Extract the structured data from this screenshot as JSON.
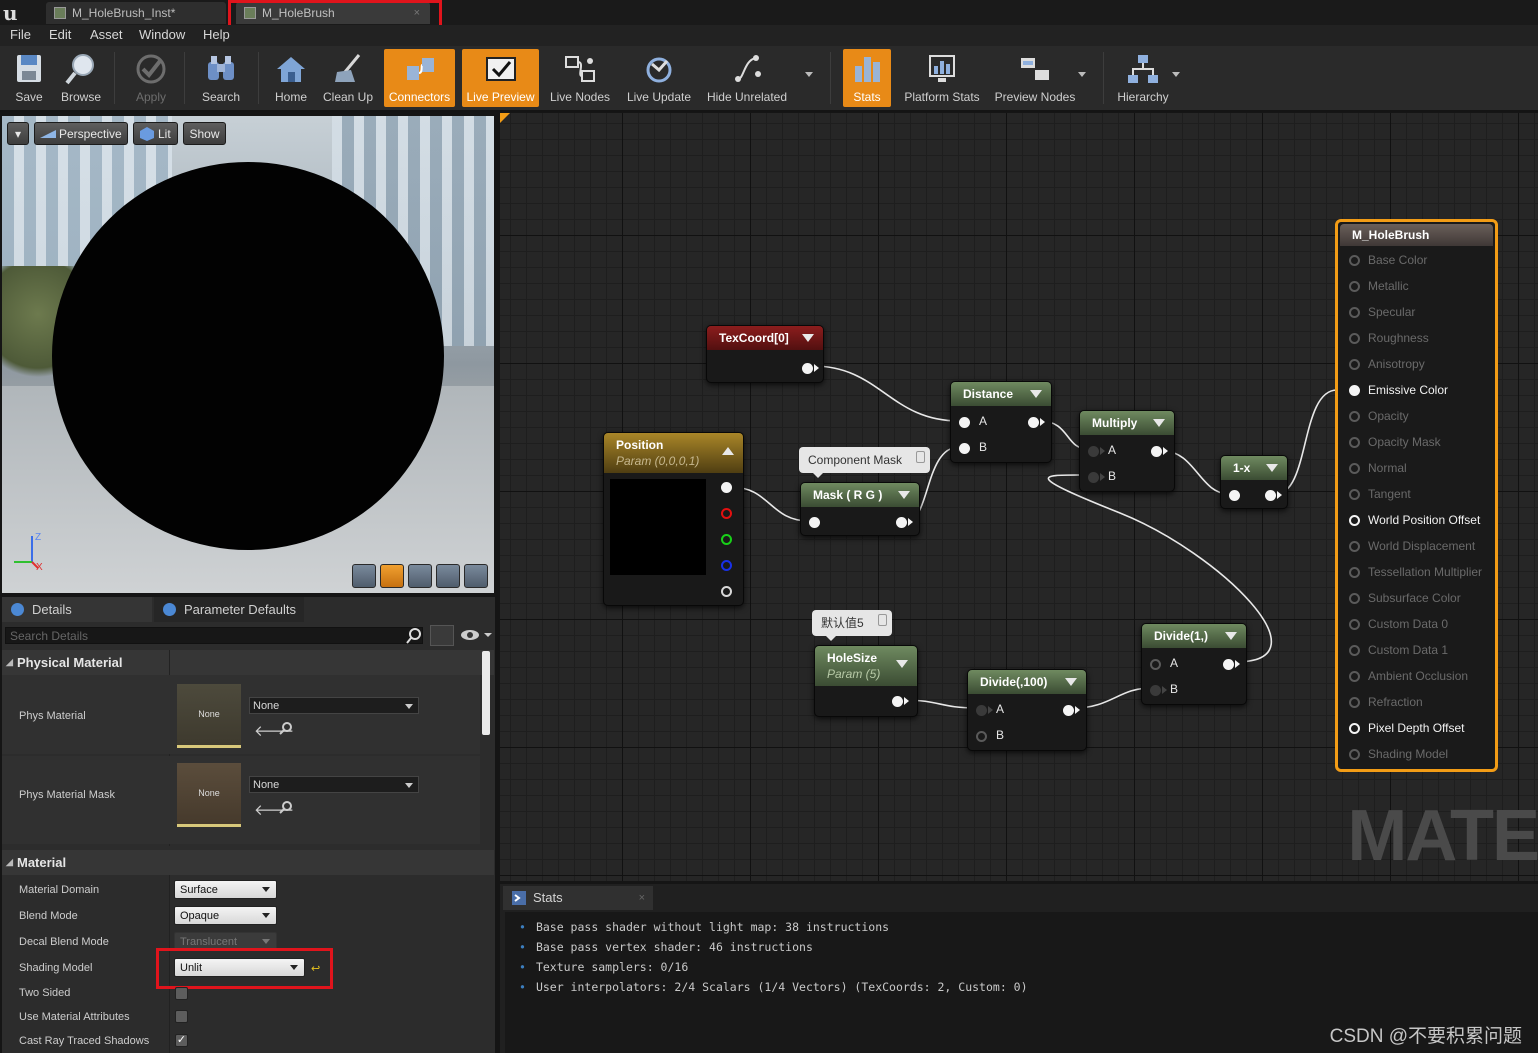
{
  "window": {
    "tabs": [
      {
        "label": "M_HoleBrush_Inst*"
      },
      {
        "label": "M_HoleBrush"
      }
    ],
    "tab_close_glyph": "×"
  },
  "menu": [
    "File",
    "Edit",
    "Asset",
    "Window",
    "Help"
  ],
  "toolbar": {
    "buttons": [
      {
        "label": "Save",
        "icon": "save-icon"
      },
      {
        "label": "Browse",
        "icon": "browse-icon"
      },
      {
        "label": "Apply",
        "icon": "apply-icon",
        "state": "disabled"
      },
      {
        "label": "Search",
        "icon": "binoculars-icon"
      },
      {
        "label": "Home",
        "icon": "home-icon"
      },
      {
        "label": "Clean Up",
        "icon": "broom-icon"
      },
      {
        "label": "Connectors",
        "icon": "connectors-icon",
        "state": "active"
      },
      {
        "label": "Live Preview",
        "icon": "live-preview-icon",
        "state": "active"
      },
      {
        "label": "Live Nodes",
        "icon": "live-nodes-icon"
      },
      {
        "label": "Live Update",
        "icon": "live-update-icon"
      },
      {
        "label": "Hide Unrelated",
        "icon": "hide-unrelated-icon"
      },
      {
        "label": "Stats",
        "icon": "stats-icon",
        "state": "active"
      },
      {
        "label": "Platform Stats",
        "icon": "platform-stats-icon"
      },
      {
        "label": "Preview Nodes",
        "icon": "preview-nodes-icon"
      },
      {
        "label": "Hierarchy",
        "icon": "hierarchy-icon"
      }
    ]
  },
  "viewport": {
    "menu_glyph": "▾",
    "perspective": "Perspective",
    "lit": "Lit",
    "show": "Show",
    "axis_z": "Z",
    "axis_x": "X"
  },
  "details": {
    "tabs": [
      "Details",
      "Parameter Defaults"
    ],
    "search_placeholder": "Search Details",
    "physical_material": {
      "header": "Physical Material",
      "rows": [
        {
          "label": "Phys Material",
          "thumb": "None",
          "value": "None"
        },
        {
          "label": "Phys Material Mask",
          "thumb": "None",
          "value": "None"
        }
      ]
    },
    "material": {
      "header": "Material",
      "rows": [
        {
          "label": "Material Domain",
          "value": "Surface"
        },
        {
          "label": "Blend Mode",
          "value": "Opaque"
        },
        {
          "label": "Decal Blend Mode",
          "value": "Translucent"
        },
        {
          "label": "Shading Model",
          "value": "Unlit"
        },
        {
          "label": "Two Sided"
        },
        {
          "label": "Use Material Attributes"
        },
        {
          "label": "Cast Ray Traced Shadows",
          "check": "✓"
        }
      ]
    }
  },
  "graph": {
    "nodes": {
      "texcoord": {
        "title": "TexCoord[0]"
      },
      "position": {
        "title": "Position",
        "subtitle": "Param (0,0,0,1)"
      },
      "component_mask_comment": "Component Mask",
      "mask": {
        "title": "Mask ( R G )"
      },
      "distance": {
        "title": "Distance",
        "pin_a": "A",
        "pin_b": "B"
      },
      "multiply": {
        "title": "Multiply",
        "pin_a": "A",
        "pin_b": "B"
      },
      "one_minus": {
        "title": "1-x"
      },
      "holesize_comment": "默认值5",
      "holesize": {
        "title": "HoleSize",
        "subtitle": "Param (5)"
      },
      "divide100": {
        "title": "Divide(,100)",
        "pin_a": "A",
        "pin_b": "B"
      },
      "divide1": {
        "title": "Divide(1,)",
        "pin_a": "A",
        "pin_b": "B"
      }
    },
    "result": {
      "title": "M_HoleBrush",
      "inputs": [
        {
          "label": "Base Color",
          "active": false
        },
        {
          "label": "Metallic",
          "active": false
        },
        {
          "label": "Specular",
          "active": false
        },
        {
          "label": "Roughness",
          "active": false
        },
        {
          "label": "Anisotropy",
          "active": false
        },
        {
          "label": "Emissive Color",
          "active": true,
          "connected": true
        },
        {
          "label": "Opacity",
          "active": false
        },
        {
          "label": "Opacity Mask",
          "active": false
        },
        {
          "label": "Normal",
          "active": false
        },
        {
          "label": "Tangent",
          "active": false
        },
        {
          "label": "World Position Offset",
          "active": true
        },
        {
          "label": "World Displacement",
          "active": false
        },
        {
          "label": "Tessellation Multiplier",
          "active": false
        },
        {
          "label": "Subsurface Color",
          "active": false
        },
        {
          "label": "Custom Data 0",
          "active": false
        },
        {
          "label": "Custom Data 1",
          "active": false
        },
        {
          "label": "Ambient Occlusion",
          "active": false
        },
        {
          "label": "Refraction",
          "active": false
        },
        {
          "label": "Pixel Depth Offset",
          "active": true
        },
        {
          "label": "Shading Model",
          "active": false
        }
      ]
    },
    "watermark": "MATE"
  },
  "stats": {
    "tab": "Stats",
    "bullet": "•",
    "lines": [
      "Base pass shader without light map: 38 instructions",
      "Base pass vertex shader: 46 instructions",
      "Texture samplers: 0/16",
      "User interpolators: 2/4 Scalars (1/4 Vectors) (TexCoords: 2, Custom: 0)"
    ]
  },
  "watermark_csdn": "CSDN @不要积累问题",
  "colors": {
    "accent_orange": "#e88a17",
    "result_border": "#f29c16",
    "highlight_red": "#e0141c",
    "graph_bg": "#262626"
  }
}
